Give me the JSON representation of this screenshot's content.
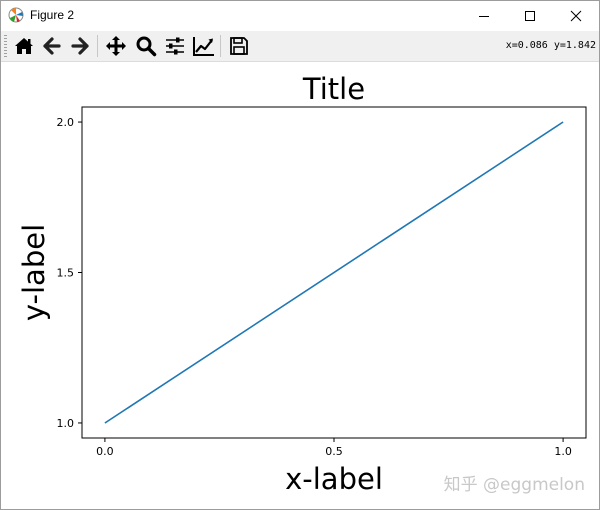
{
  "window": {
    "title": "Figure 2",
    "controls": [
      "minimize",
      "maximize",
      "close"
    ]
  },
  "toolbar": {
    "buttons": [
      {
        "name": "home-icon",
        "tooltip": "Reset original view"
      },
      {
        "name": "back-icon",
        "tooltip": "Back to previous view"
      },
      {
        "name": "forward-icon",
        "tooltip": "Forward to next view"
      },
      {
        "name": "pan-icon",
        "tooltip": "Pan axes"
      },
      {
        "name": "zoom-icon",
        "tooltip": "Zoom to rectangle"
      },
      {
        "name": "subplots-icon",
        "tooltip": "Configure subplots"
      },
      {
        "name": "edit-axis-icon",
        "tooltip": "Edit axis"
      },
      {
        "name": "save-icon",
        "tooltip": "Save the figure"
      }
    ],
    "coords": "x=0.086 y=1.842"
  },
  "watermark": "知乎 @eggmelon",
  "colors": {
    "line": "#1f77b4",
    "toolbar_bg": "#f0f0f0",
    "text": "#000000"
  },
  "chart_data": {
    "type": "line",
    "title": "Title",
    "xlabel": "x-label",
    "ylabel": "y-label",
    "x": [
      0.0,
      1.0
    ],
    "series": [
      {
        "values": [
          1.0,
          2.0
        ]
      }
    ],
    "xlim": [
      -0.05,
      1.05
    ],
    "ylim": [
      0.95,
      2.05
    ],
    "xticks": [
      0.0,
      0.5,
      1.0
    ],
    "xtick_labels": [
      "0.0",
      "0.5",
      "1.0"
    ],
    "yticks": [
      1.0,
      1.5,
      2.0
    ],
    "ytick_labels": [
      "1.0",
      "1.5",
      "2.0"
    ],
    "grid": false,
    "legend": "none"
  }
}
